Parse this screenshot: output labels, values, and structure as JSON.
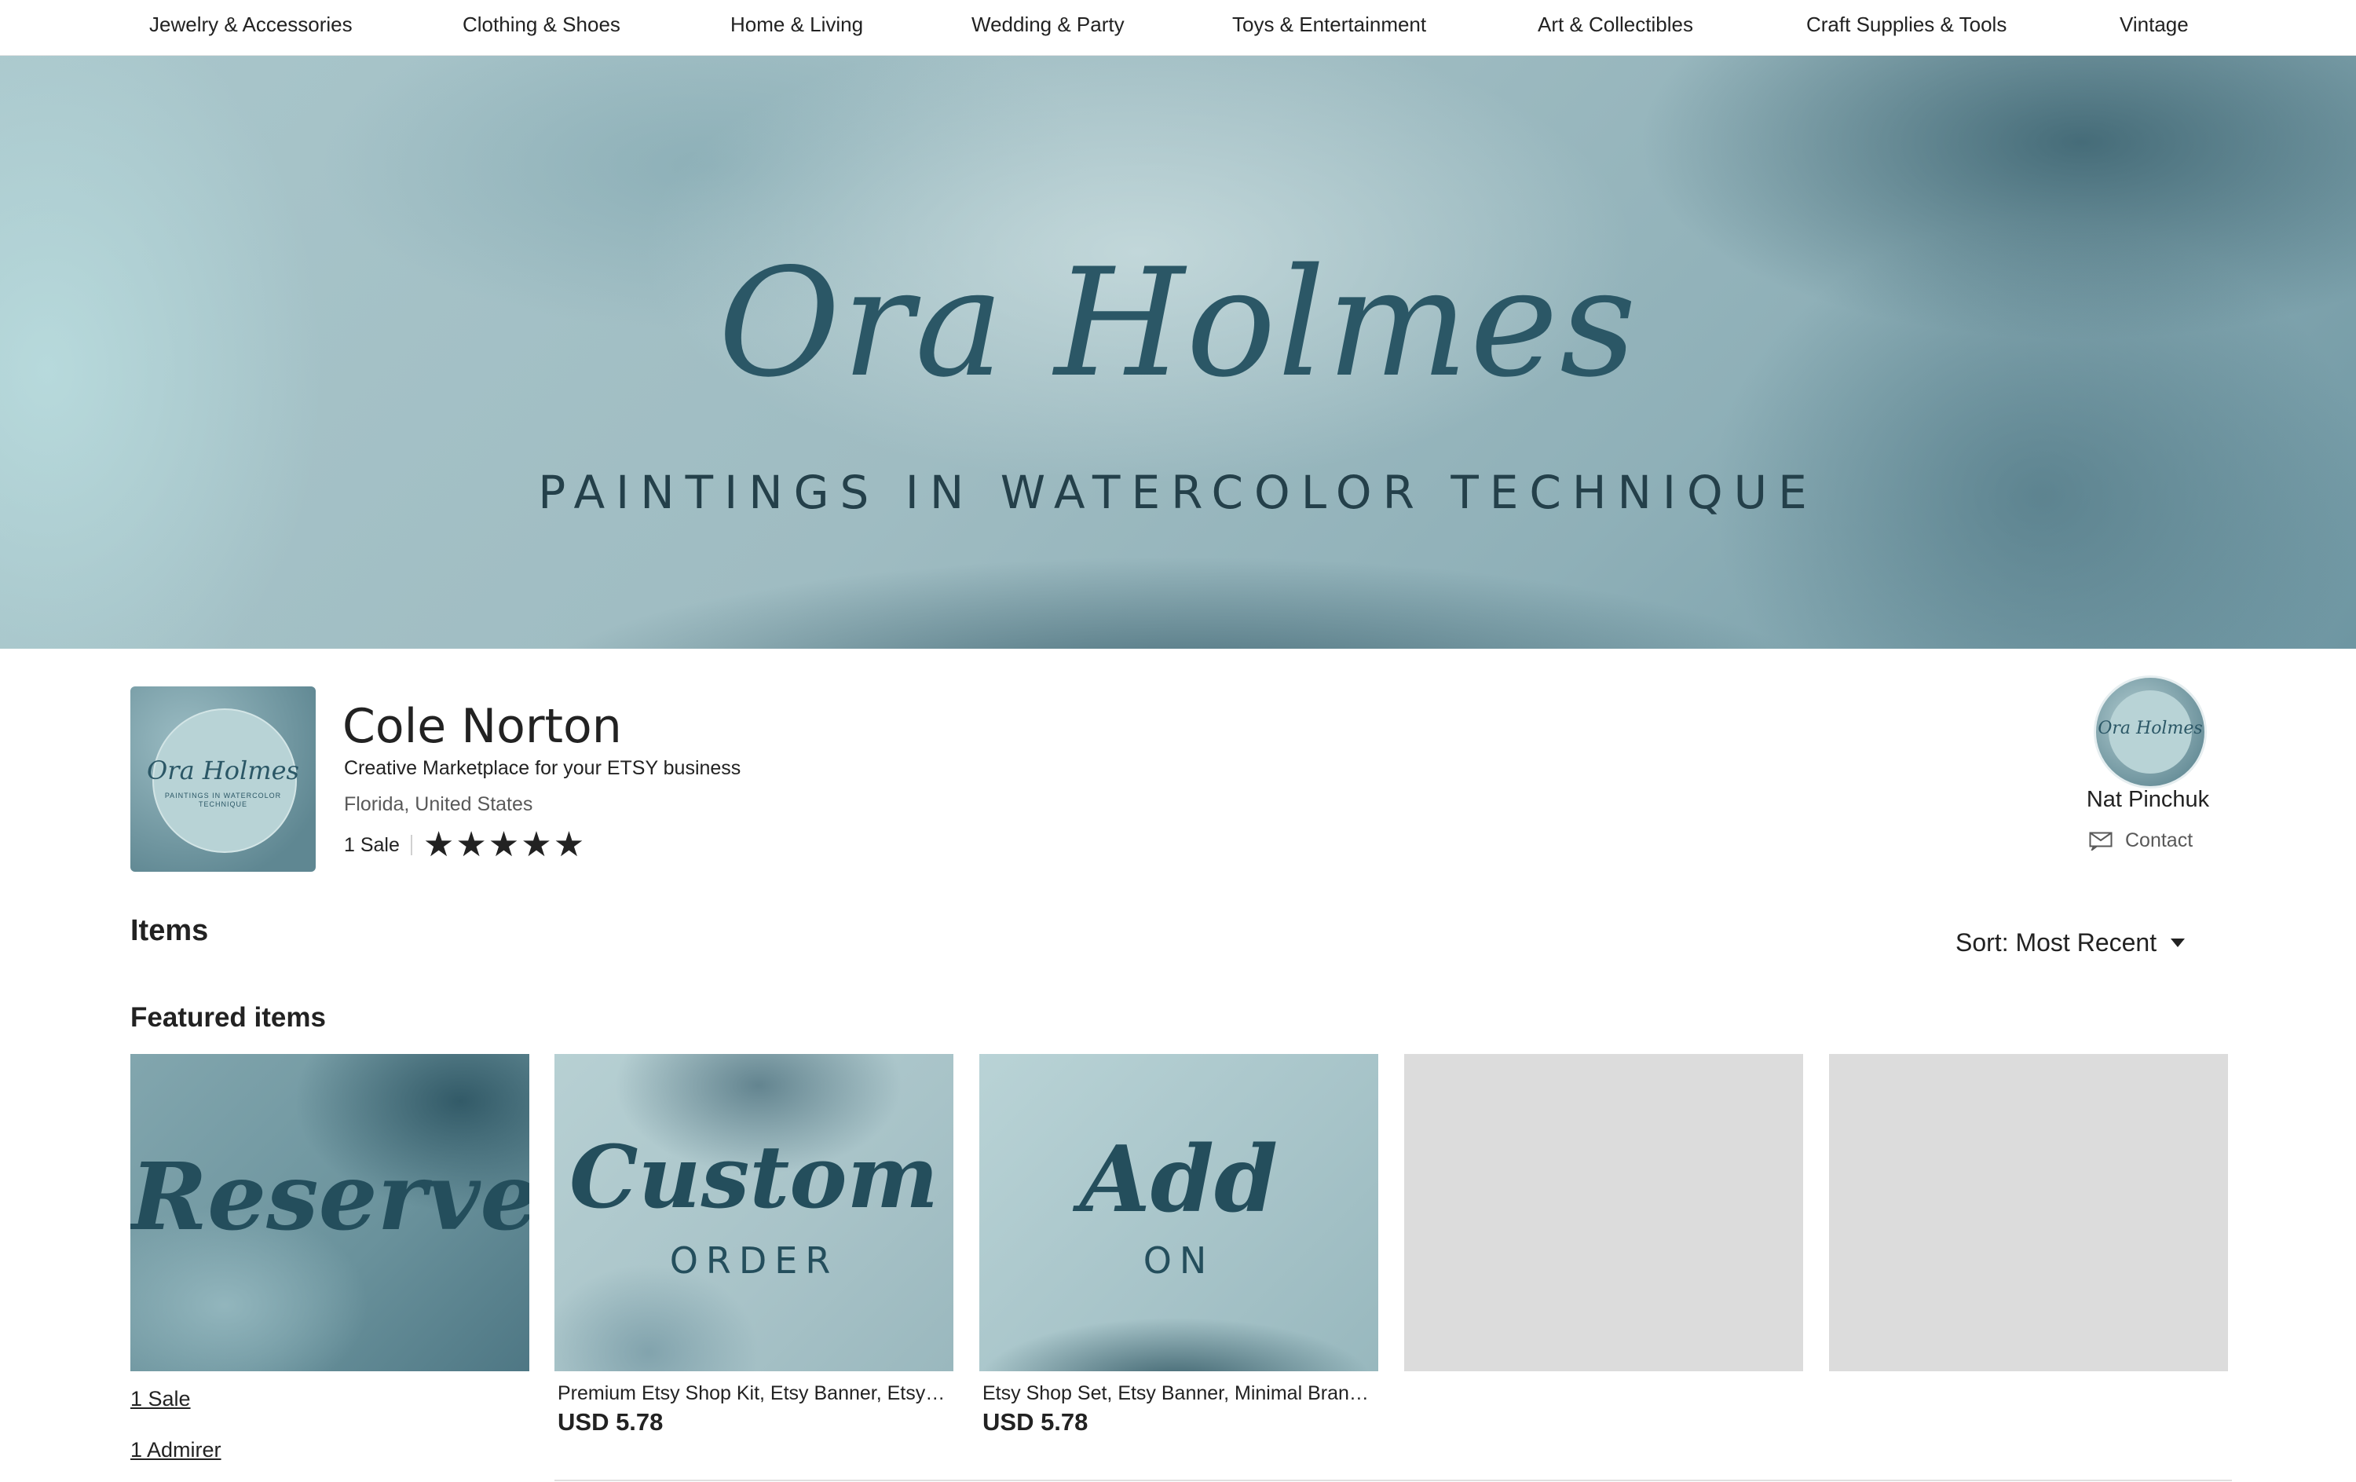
{
  "topnav": {
    "categories": [
      "Jewelry & Accessories",
      "Clothing & Shoes",
      "Home & Living",
      "Wedding & Party",
      "Toys & Entertainment",
      "Art & Collectibles",
      "Craft Supplies & Tools",
      "Vintage"
    ]
  },
  "banner": {
    "title": "Ora Holmes",
    "subtitle": "PAINTINGS IN WATERCOLOR TECHNIQUE"
  },
  "shop": {
    "logo_title": "Ora Holmes",
    "logo_subtitle": "PAINTINGS IN WATERCOLOR TECHNIQUE",
    "name": "Cole Norton",
    "tagline": "Creative Marketplace for your ETSY business",
    "location": "Florida, United States",
    "sales": "1 Sale",
    "rating": 5,
    "star_glyph": "★"
  },
  "owner": {
    "avatar_text": "Ora Holmes",
    "name": "Nat Pinchuk",
    "contact_label": "Contact"
  },
  "items": {
    "heading": "Items",
    "sort_label": "Sort: Most Recent",
    "featured_heading": "Featured items",
    "cards": [
      {
        "script": "Reserved",
        "caps": "",
        "link1": "1 Sale",
        "link2": "1 Admirer"
      },
      {
        "script": "Custom",
        "caps": "ORDER",
        "title": "Premium Etsy Shop Kit, Etsy Banner, Etsy Shop Banner, Shop Icon",
        "price": "USD 5.78"
      },
      {
        "script": "Add",
        "caps": "ON",
        "title": "Etsy Shop Set, Etsy Banner, Minimal Branding Kit, Shop Icon",
        "price": "USD 5.78"
      },
      {
        "placeholder": true
      },
      {
        "placeholder": true
      }
    ]
  },
  "colors": {
    "brand_teal": "#2b5766",
    "text": "#222222",
    "muted": "#595959",
    "placeholder": "#dcdcdc"
  }
}
